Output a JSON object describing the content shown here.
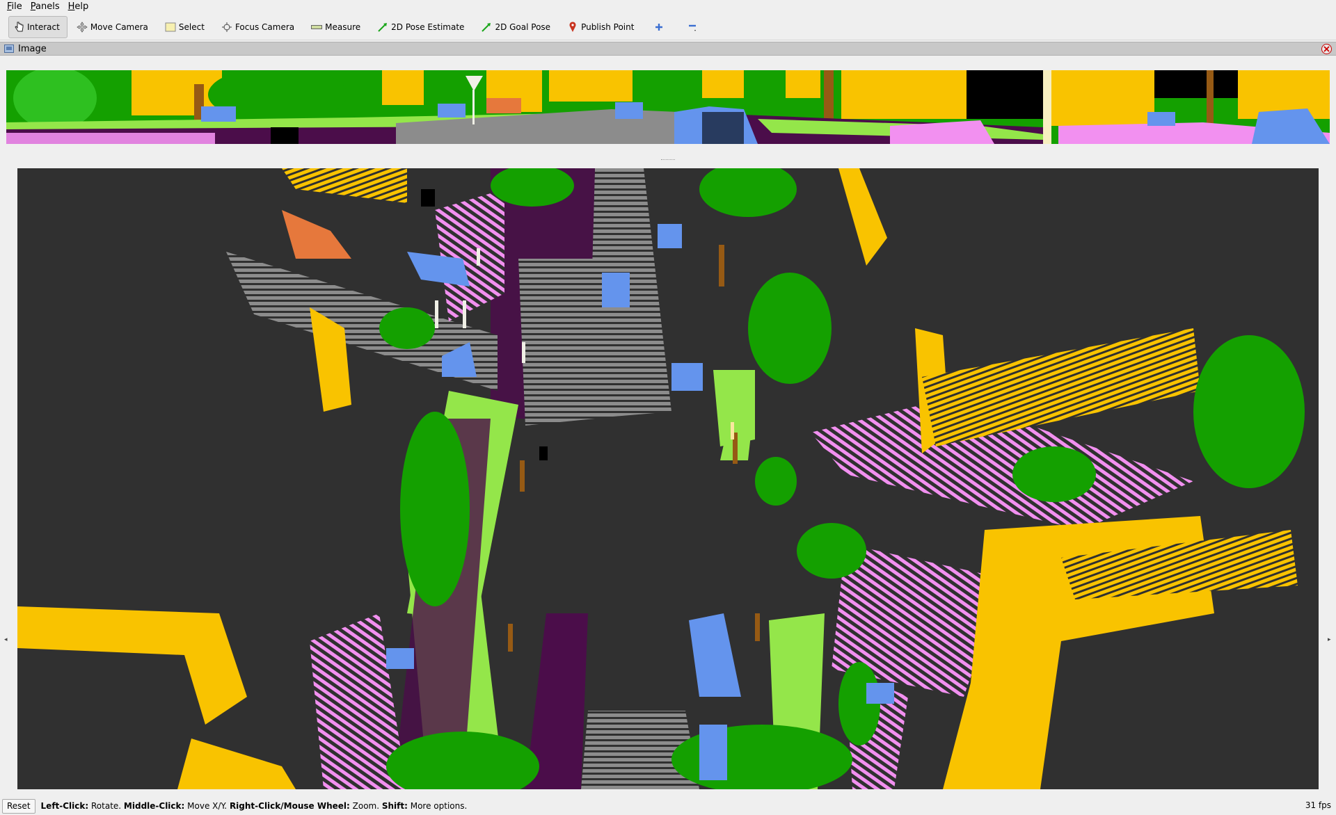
{
  "menubar": {
    "items": [
      {
        "label": "File",
        "accel": "F",
        "rest": "ile"
      },
      {
        "label": "Panels",
        "accel": "P",
        "rest": "anels"
      },
      {
        "label": "Help",
        "accel": "H",
        "rest": "elp"
      }
    ]
  },
  "toolbar": {
    "tools": [
      {
        "label": "Interact",
        "icon": "hand-pointer-icon",
        "active": true
      },
      {
        "label": "Move Camera",
        "icon": "move-arrows-icon"
      },
      {
        "label": "Select",
        "icon": "select-rect-icon"
      },
      {
        "label": "Focus Camera",
        "icon": "crosshair-icon"
      },
      {
        "label": "Measure",
        "icon": "ruler-icon"
      },
      {
        "label": "2D Pose Estimate",
        "icon": "green-arrow-icon"
      },
      {
        "label": "2D Goal Pose",
        "icon": "green-arrow-icon"
      },
      {
        "label": "Publish Point",
        "icon": "map-pin-icon"
      }
    ],
    "add_icon": "plus-icon",
    "remove_icon": "minus-icon"
  },
  "image_panel": {
    "title": "Image",
    "close_icon": "close-icon"
  },
  "colors": {
    "building": "#f9c300",
    "vegetation": "#14a000",
    "terrain": "#94e64a",
    "sidewalk": "#f290f0",
    "road_marking": "#4b0d4a",
    "car": "#6494ed",
    "road": "#323232",
    "pole": "#f0f0e6",
    "fence": "#e6783c",
    "trunk": "#965a14",
    "parking": "#8c8c8c"
  },
  "statusbar": {
    "reset_label": "Reset",
    "hint": [
      {
        "bold": "Left-Click:",
        "text": " Rotate. "
      },
      {
        "bold": "Middle-Click:",
        "text": " Move X/Y. "
      },
      {
        "bold": "Right-Click/Mouse Wheel:",
        "text": " Zoom. "
      },
      {
        "bold": "Shift:",
        "text": " More options."
      }
    ],
    "fps": "31 fps"
  }
}
